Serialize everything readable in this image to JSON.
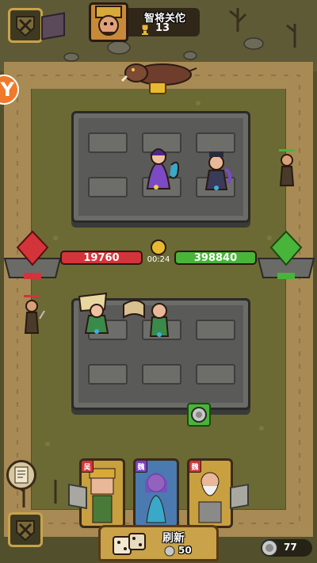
{
  "header": {
    "opponent_name": "智将关佗",
    "trophy_count": "13"
  },
  "battle": {
    "enemy_hp": "19760",
    "player_hp": "398840",
    "timer": "00:24",
    "colors": {
      "enemy": "#d3343a",
      "player": "#49b43a",
      "path": "#a88a55"
    }
  },
  "cards": [
    {
      "faction_label": "吴",
      "faction_color": "#d3343a"
    },
    {
      "faction_label": "魏",
      "faction_color": "#7b3fc4"
    },
    {
      "faction_label": "魏",
      "faction_color": "#d3343a"
    }
  ],
  "refresh": {
    "label": "刷新",
    "cost": "50"
  },
  "currency": {
    "amount": "77"
  },
  "icons": [
    "shield-swords-icon",
    "trophy-icon",
    "coin-icon",
    "dice-icon",
    "scroll-icon",
    "gem-icon",
    "clock-icon",
    "chest-icon"
  ]
}
